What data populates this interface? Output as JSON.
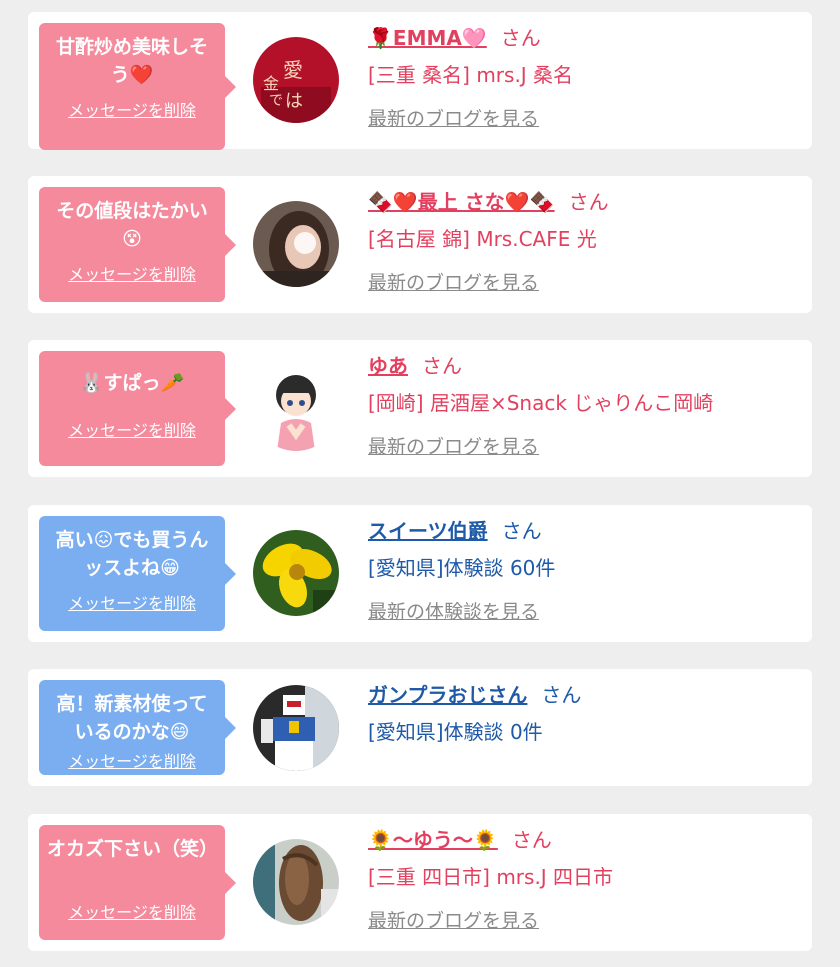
{
  "cards": [
    {
      "message": "甘酢炒め美味しそう❤️",
      "delete_label": "メッセージを削除",
      "name": "🌹EMMA🩷",
      "suffix": "さん",
      "shop": "[三重 桑名] mrs.J 桑名",
      "link": "最新のブログを見る",
      "theme": "pink",
      "avatar": "red-sweater-photo"
    },
    {
      "message": "その値段はたかい😵",
      "delete_label": "メッセージを削除",
      "name": "🍫❤️最上 さな❤️🍫",
      "suffix": "さん",
      "shop": "[名古屋 錦] Mrs.CAFE 光",
      "link": "最新のブログを見る",
      "theme": "pink",
      "avatar": "girl-photo"
    },
    {
      "message": "🐰すぱっ🥕",
      "delete_label": "メッセージを削除",
      "name": "ゆあ",
      "suffix": "さん",
      "shop": "[岡崎] 居酒屋×Snack じゃりんこ岡崎",
      "link": "最新のブログを見る",
      "theme": "pink",
      "avatar": "girl-illustration"
    },
    {
      "message": "高い😖でも買うんッスよね😁",
      "delete_label": "メッセージを削除",
      "name": "スイーツ伯爵",
      "suffix": "さん",
      "shop": "[愛知県]体験談 60件",
      "link": "最新の体験談を見る",
      "theme": "blue",
      "avatar": "yellow-flower-photo"
    },
    {
      "message": "高！新素材使っているのかな😄",
      "delete_label": "メッセージを削除",
      "name": "ガンプラおじさん",
      "suffix": "さん",
      "shop": "[愛知県]体験談 0件",
      "link": "",
      "theme": "blue",
      "avatar": "robot-model-photo"
    },
    {
      "message": "オカズ下さい（笑）",
      "delete_label": "メッセージを削除",
      "name": "🌻〜ゆう〜🌻",
      "suffix": "さん",
      "shop": "[三重 四日市] mrs.J 四日市",
      "link": "最新のブログを見る",
      "theme": "pink",
      "avatar": "hair-photo"
    }
  ],
  "colors": {
    "pink_bubble": "#f48a9c",
    "blue_bubble": "#7aaef0",
    "pink_text": "#e3405f",
    "blue_text": "#1e5aa8",
    "link_gray": "#8a8a8a",
    "page_bg": "#eeeeee"
  }
}
